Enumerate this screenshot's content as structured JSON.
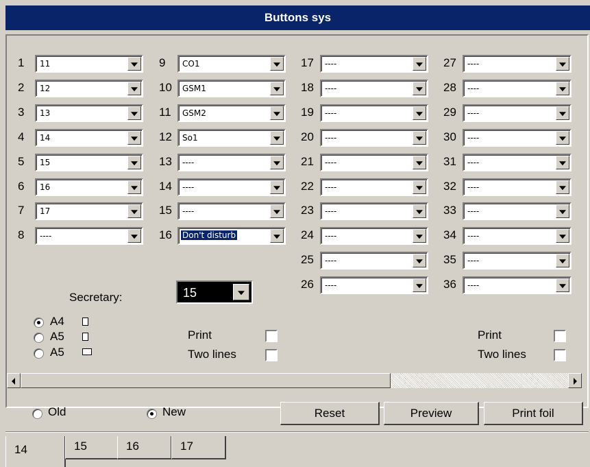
{
  "window": {
    "title": "Buttons sys"
  },
  "columns": [
    {
      "rows": [
        {
          "num": "1",
          "value": "11"
        },
        {
          "num": "2",
          "value": "12"
        },
        {
          "num": "3",
          "value": "13"
        },
        {
          "num": "4",
          "value": "14"
        },
        {
          "num": "5",
          "value": "15"
        },
        {
          "num": "6",
          "value": "16"
        },
        {
          "num": "7",
          "value": "17"
        },
        {
          "num": "8",
          "value": "----"
        }
      ]
    },
    {
      "rows": [
        {
          "num": "9",
          "value": "CO1"
        },
        {
          "num": "10",
          "value": "GSM1"
        },
        {
          "num": "11",
          "value": "GSM2"
        },
        {
          "num": "12",
          "value": "So1"
        },
        {
          "num": "13",
          "value": "----"
        },
        {
          "num": "14",
          "value": "----"
        },
        {
          "num": "15",
          "value": "----"
        },
        {
          "num": "16",
          "value": "Don't disturb",
          "selected": true
        }
      ]
    },
    {
      "rows": [
        {
          "num": "17",
          "value": "----"
        },
        {
          "num": "18",
          "value": "----"
        },
        {
          "num": "19",
          "value": "----"
        },
        {
          "num": "20",
          "value": "----"
        },
        {
          "num": "21",
          "value": "----"
        },
        {
          "num": "22",
          "value": "----"
        },
        {
          "num": "23",
          "value": "----"
        },
        {
          "num": "24",
          "value": "----"
        },
        {
          "num": "25",
          "value": "----"
        },
        {
          "num": "26",
          "value": "----"
        }
      ]
    },
    {
      "rows": [
        {
          "num": "27",
          "value": "----"
        },
        {
          "num": "28",
          "value": "----"
        },
        {
          "num": "29",
          "value": "----"
        },
        {
          "num": "30",
          "value": "----"
        },
        {
          "num": "31",
          "value": "----"
        },
        {
          "num": "32",
          "value": "----"
        },
        {
          "num": "33",
          "value": "----"
        },
        {
          "num": "34",
          "value": "----"
        },
        {
          "num": "35",
          "value": "----"
        },
        {
          "num": "36",
          "value": "----"
        }
      ]
    }
  ],
  "secretary": {
    "label": "Secretary:",
    "value": "15"
  },
  "paper": {
    "options": [
      {
        "label": "A4",
        "checked": true,
        "icon": "portrait-page-icon"
      },
      {
        "label": "A5",
        "checked": false,
        "icon": "portrait-page-icon"
      },
      {
        "label": "A5",
        "checked": false,
        "icon": "landscape-page-icon"
      }
    ]
  },
  "print_left": {
    "print_label": "Print",
    "two_lines_label": "Two lines",
    "print_checked": false,
    "two_lines_checked": false
  },
  "print_right": {
    "print_label": "Print",
    "two_lines_label": "Two lines",
    "print_checked": false,
    "two_lines_checked": false
  },
  "mode": {
    "old_label": "Old",
    "new_label": "New",
    "selected": "New"
  },
  "buttons": {
    "reset": "Reset",
    "preview": "Preview",
    "print_foil": "Print foil"
  },
  "tabs": [
    {
      "label": "14",
      "active": true
    },
    {
      "label": "15"
    },
    {
      "label": "16"
    },
    {
      "label": "17"
    }
  ]
}
